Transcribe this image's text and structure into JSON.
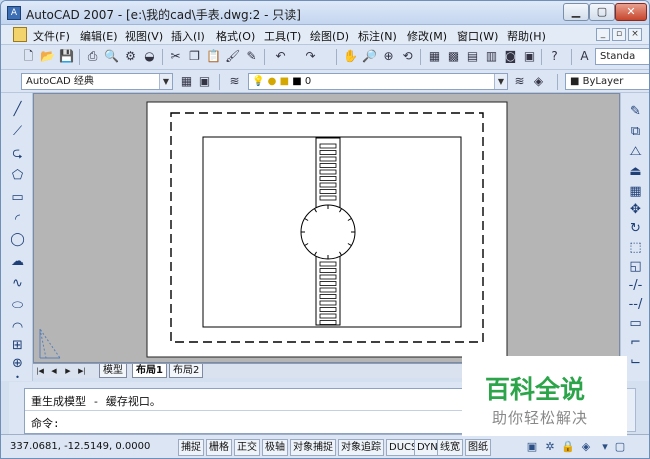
{
  "window": {
    "title": "AutoCAD 2007 - [e:\\我的cad\\手表.dwg:2 - 只读]",
    "app_icon": "autocad-logo-icon",
    "controls": [
      "minimize-icon",
      "maximize-icon",
      "close-icon"
    ]
  },
  "menubar": {
    "items": [
      {
        "label": "文件(F)"
      },
      {
        "label": "编辑(E)"
      },
      {
        "label": "视图(V)"
      },
      {
        "label": "插入(I)"
      },
      {
        "label": "格式(O)"
      },
      {
        "label": "工具(T)"
      },
      {
        "label": "绘图(D)"
      },
      {
        "label": "标注(N)"
      },
      {
        "label": "修改(M)"
      },
      {
        "label": "窗口(W)"
      },
      {
        "label": "帮助(H)"
      }
    ],
    "mdi_controls": [
      "_",
      "▫",
      "×"
    ]
  },
  "toolbar1": {
    "style_combo_value": "Standa"
  },
  "toolbar2": {
    "workspace": "AutoCAD 经典",
    "layer_value": "0",
    "linetype_value": "ByLayer"
  },
  "layout_tabs": {
    "nav": [
      "|◀",
      "◀",
      "▶",
      "▶|"
    ],
    "tabs": [
      {
        "label": "模型"
      },
      {
        "label": "布局1"
      },
      {
        "label": "布局2"
      }
    ]
  },
  "command": {
    "history": "重生成模型 - 缓存视口。",
    "prompt": "命令:"
  },
  "statusbar": {
    "coordinates": "337.0681, -12.5149, 0.0000",
    "toggles": [
      "捕捉",
      "栅格",
      "正交",
      "极轴",
      "对象捕捉",
      "对象追踪",
      "DUCS",
      "DYN",
      "线宽",
      "图纸"
    ]
  },
  "watermark": {
    "title": "百科全说",
    "subtitle": "助你轻松解决"
  }
}
